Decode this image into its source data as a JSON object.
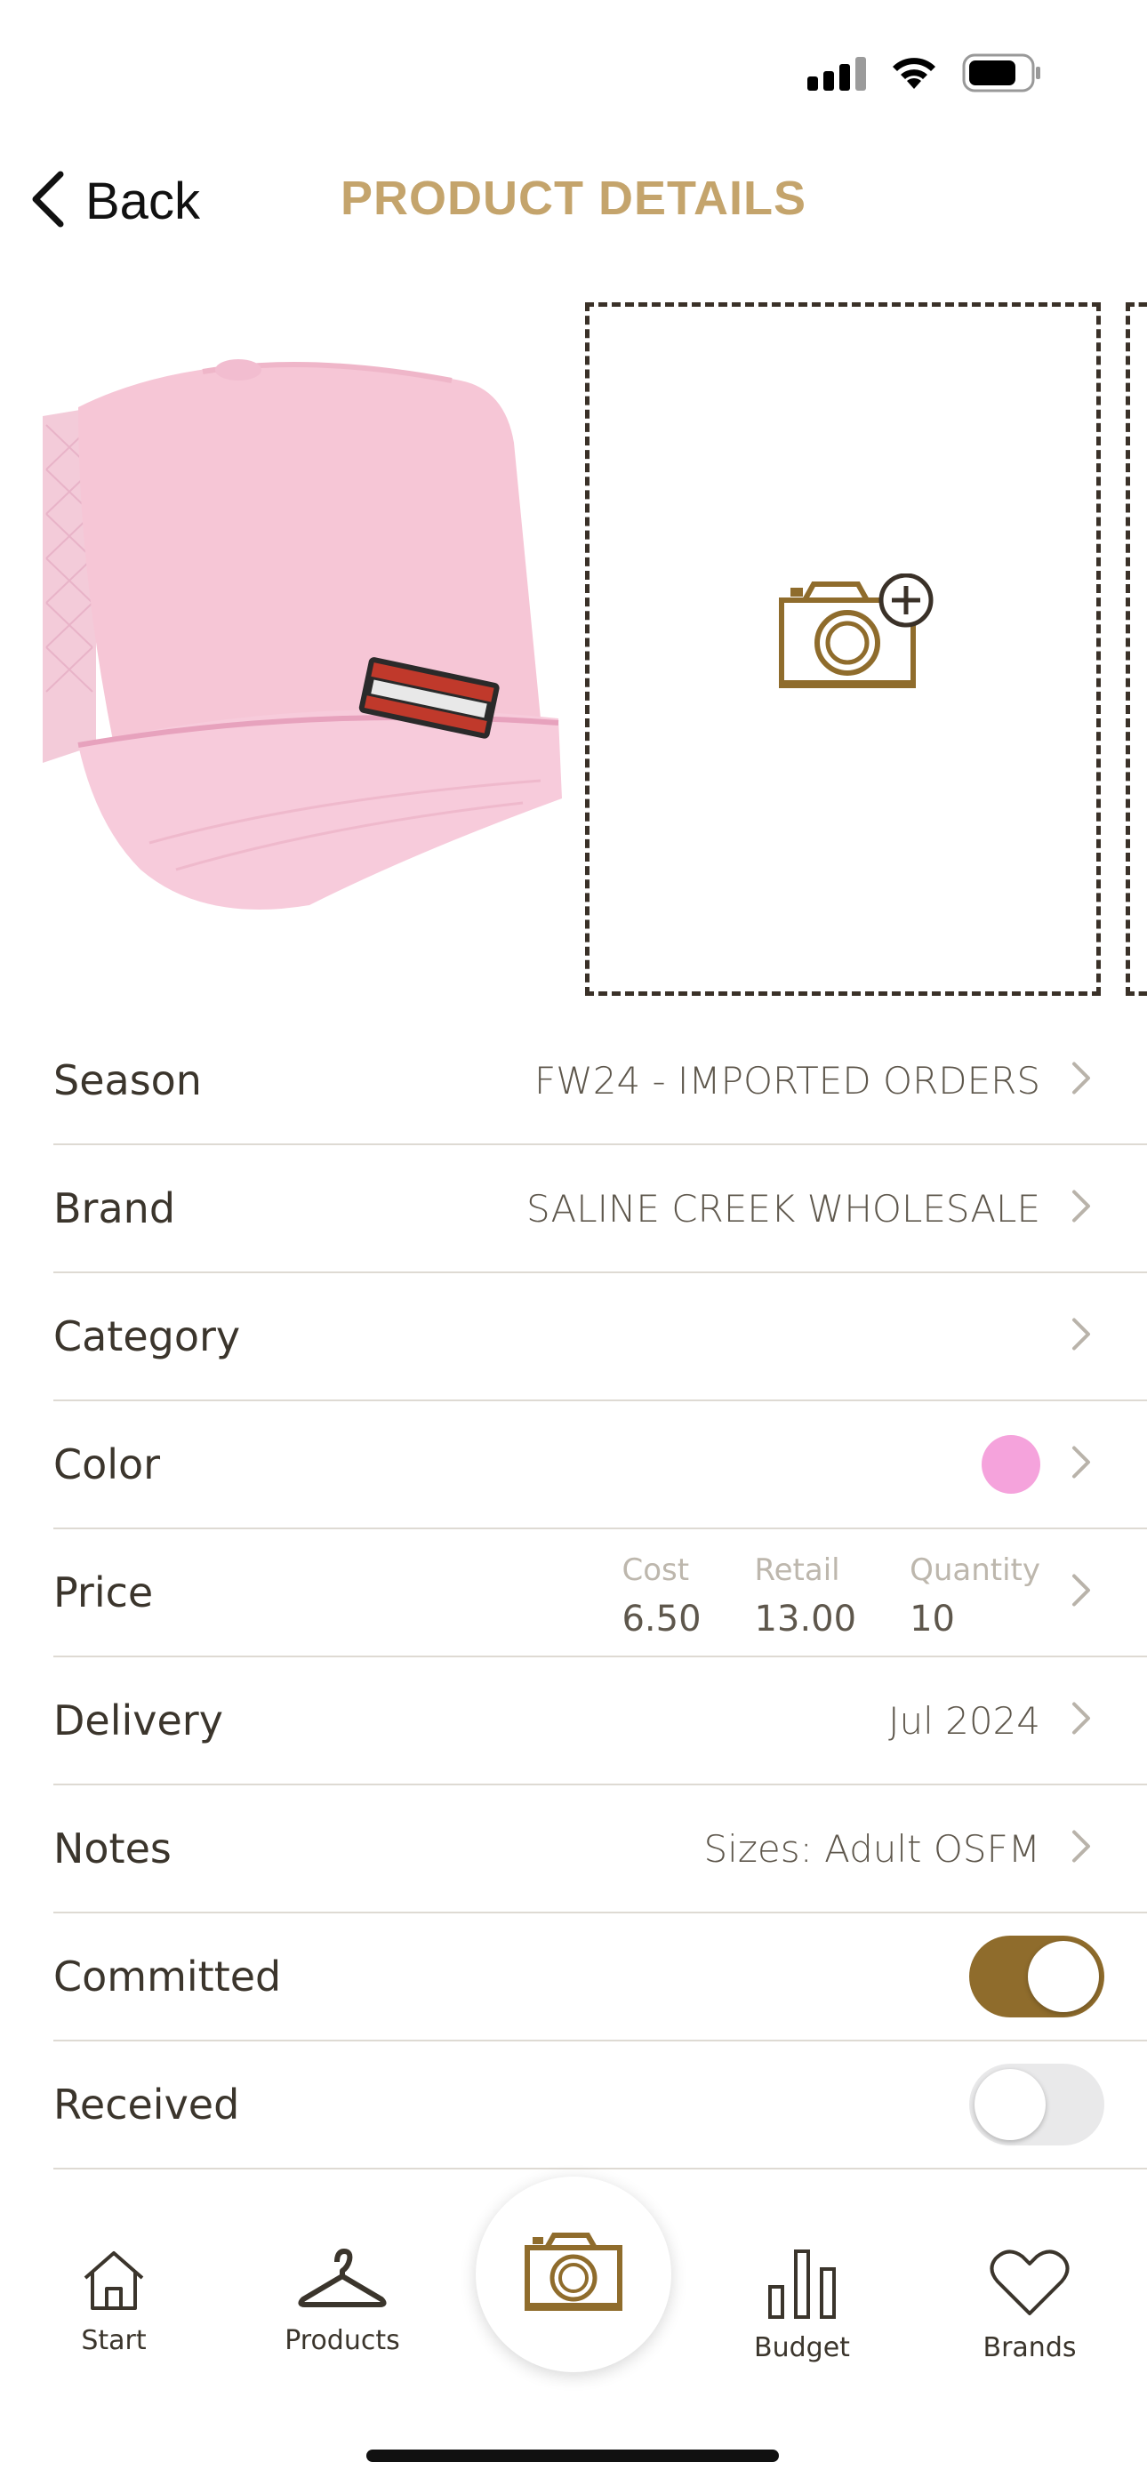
{
  "nav": {
    "back_label": "Back",
    "title": "PRODUCT DETAILS"
  },
  "gallery": {
    "product_image": "pink-trucker-hat",
    "add_photo_icon": "camera-plus-icon"
  },
  "details": {
    "season": {
      "label": "Season",
      "value": "FW24 - IMPORTED ORDERS"
    },
    "brand": {
      "label": "Brand",
      "value": "SALINE CREEK WHOLESALE"
    },
    "category": {
      "label": "Category",
      "value": ""
    },
    "color": {
      "label": "Color",
      "swatch": "#f5a3dc"
    },
    "price": {
      "label": "Price",
      "cost_label": "Cost",
      "cost": "6.50",
      "retail_label": "Retail",
      "retail": "13.00",
      "quantity_label": "Quantity",
      "quantity": "10"
    },
    "delivery": {
      "label": "Delivery",
      "value": "Jul 2024"
    },
    "notes": {
      "label": "Notes",
      "value": "Sizes: Adult OSFM"
    },
    "committed": {
      "label": "Committed",
      "on": true
    },
    "received": {
      "label": "Received",
      "on": false
    }
  },
  "tabs": [
    {
      "label": "Start",
      "icon": "home-icon"
    },
    {
      "label": "Products",
      "icon": "hanger-icon"
    },
    {
      "label": "",
      "icon": "camera-icon"
    },
    {
      "label": "Budget",
      "icon": "bar-chart-icon"
    },
    {
      "label": "Brands",
      "icon": "heart-icon"
    }
  ],
  "colors": {
    "accent": "#8f6c2c",
    "title": "#c4a46c",
    "toggle_on": "#8f6c2c",
    "toggle_off": "#e9e9ea"
  }
}
